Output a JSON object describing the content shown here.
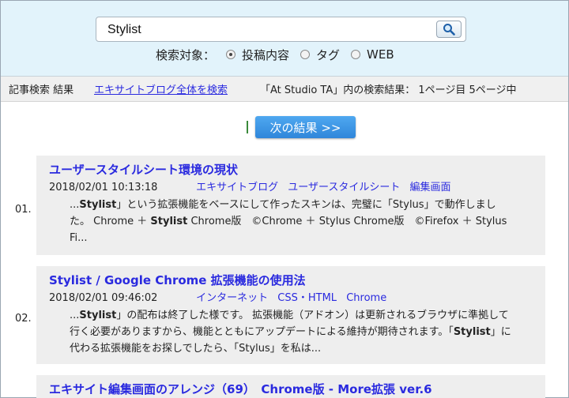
{
  "search": {
    "query": "Stylist",
    "target_label": "検索対象：",
    "options": [
      "投稿内容",
      "タグ",
      "WEB"
    ],
    "selected": "投稿内容"
  },
  "results_bar": {
    "label": "記事検索 結果",
    "link": "エキサイトブログ全体を検索",
    "summary": "「At Studio TA」内の検索結果： 1ページ目 5ページ中"
  },
  "next_button": "次の結果 >>",
  "entries": [
    {
      "num": "01.",
      "title": "ユーザースタイルシート環境の現状",
      "date": "2018/02/01 10:13:18",
      "categories": [
        "エキサイトブログ",
        "ユーザースタイルシート",
        "編集画面"
      ],
      "excerpt": "...Stylist」という拡張機能をベースにして作ったスキンは、完璧に「Stylus」で動作しました。 Chrome ＋ Stylist Chrome版　©Chrome ＋ Stylus Chrome版　©Firefox ＋ Stylus Fi..."
    },
    {
      "num": "02.",
      "title": "Stylist / Google Chrome 拡張機能の使用法",
      "date": "2018/02/01 09:46:02",
      "categories": [
        "インターネット",
        "CSS・HTML",
        "Chrome"
      ],
      "excerpt": "...Stylist」の配布は終了した様です。 拡張機能（アドオン）は更新されるブラウザに準拠して行く必要がありますから、機能とともにアップデートによる維持が期待されます。「Stylist」に代わる拡張機能をお探しでしたら、「Stylus」を私は..."
    },
    {
      "num": "03.",
      "title": "エキサイト編集画面のアレンジ（69）　Chrome版 - More拡張 ver.6",
      "date": "",
      "categories": [],
      "excerpt": ""
    }
  ],
  "colors": {
    "search_bg": "#e2f3fb",
    "link": "#2a2adf",
    "card_bg": "#eeeeee",
    "next_button": "#3a92e0"
  }
}
